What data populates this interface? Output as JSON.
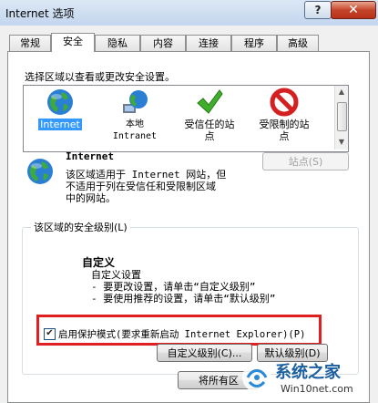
{
  "window": {
    "title": "Internet 选项",
    "help_label": "?",
    "close_label": "✕"
  },
  "tabs": [
    {
      "label": "常规"
    },
    {
      "label": "安全"
    },
    {
      "label": "隐私"
    },
    {
      "label": "内容"
    },
    {
      "label": "连接"
    },
    {
      "label": "程序"
    },
    {
      "label": "高级"
    }
  ],
  "active_tab": "安全",
  "security": {
    "instruction": "选择区域以查看或更改安全设置。",
    "zones": [
      {
        "name": "Internet",
        "icon": "globe-icon",
        "selected": true
      },
      {
        "name": "本地\nIntranet",
        "icon": "intranet-globe-icon"
      },
      {
        "name": "受信任的站\n点",
        "icon": "check-icon"
      },
      {
        "name": "受限制的站\n点",
        "icon": "restricted-icon"
      }
    ],
    "zone_info": {
      "title": "Internet",
      "description_line1": "该区域适用于 Internet 网站，但",
      "description_line2": "不适用于列在受信任和受限制区域",
      "description_line3": "中的网站。",
      "sites_button": "站点(S)"
    },
    "level_group": {
      "legend": "该区域的安全级别(L)",
      "level_name": "自定义",
      "custom_lines": [
        "自定义设置",
        "- 要更改设置，请单击“自定义级别”",
        "- 要使用推荐的设置，请单击“默认级别”"
      ],
      "protected_mode_label": "启用保护模式(要求重新启动 Internet Explorer)(P)",
      "protected_mode_checked": true,
      "custom_level_button": "自定义级别(C)...",
      "default_level_button": "默认级别(D)"
    },
    "reset_all_button": "将所有区"
  },
  "watermark": {
    "brand": "系统之家",
    "url": "Win10net.com"
  },
  "colors": {
    "selection": "#3399ff",
    "highlight_box": "#e02020"
  }
}
